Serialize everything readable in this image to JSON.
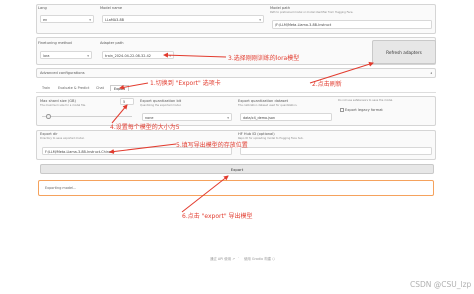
{
  "top": {
    "lang": {
      "label": "Lang",
      "value": "en"
    },
    "model_name": {
      "label": "Model name",
      "value": "LLaMA3-8B"
    },
    "model_path": {
      "label": "Model path",
      "help": "Path to pretrained model or model identifier from Hugging Face.",
      "value": "/F:/LLM/Meta-Llama-3-8B-Instruct"
    },
    "finetuning_method": {
      "label": "Finetuning method",
      "value": "lora"
    },
    "adapter_path": {
      "label": "Adapter path",
      "value": "train_2024-04-22-08-32-42"
    },
    "refresh_label": "Refresh adapters"
  },
  "advanced": {
    "label": "Advanced configurations"
  },
  "tabs": [
    "Train",
    "Evaluate & Predict",
    "Chat",
    "Export"
  ],
  "export": {
    "max_shard": {
      "label": "Max shard size (GB)",
      "help": "The maximum size for a model file.",
      "value": "5"
    },
    "quant_bit": {
      "label": "Export quantization bit",
      "help": "Quantizing the exported model.",
      "value": "none"
    },
    "quant_dataset": {
      "label": "Export quantization dataset",
      "help": "The calibration dataset used for quantization.",
      "value": "data/c4_demo.json"
    },
    "legacy": {
      "help": "Do not use safetensors to save the model.",
      "label": "Export legacy format"
    },
    "export_dir": {
      "label": "Export dir",
      "help": "Directory to save exported model.",
      "value": "F:/LLM/Meta-Llama-3-8B-Instruct-Chinese"
    },
    "hub_id": {
      "label": "HF Hub ID (optional)",
      "help": "Repo ID for uploading model to Hugging Face hub."
    },
    "export_button": "Export",
    "status": "Exporting model..."
  },
  "annotations": {
    "a1": "1.切换到 \"Export\" 选项卡",
    "a2": "2.点击刷新",
    "a3": "3.选择刚刚训练的lora模型",
    "a4": "4.设置每个模型的大小为5",
    "a5": "5.填写导出模型的存放位置",
    "a6": "6.点击 \"export\" 导出模型"
  },
  "footer": {
    "api": "通过 API 使用",
    "built": "使用 Gradio 构建"
  },
  "watermark": "CSDN @CSU_lzp",
  "colors": {
    "annotation": "#e23b2e",
    "status_border": "#f5a25d"
  }
}
